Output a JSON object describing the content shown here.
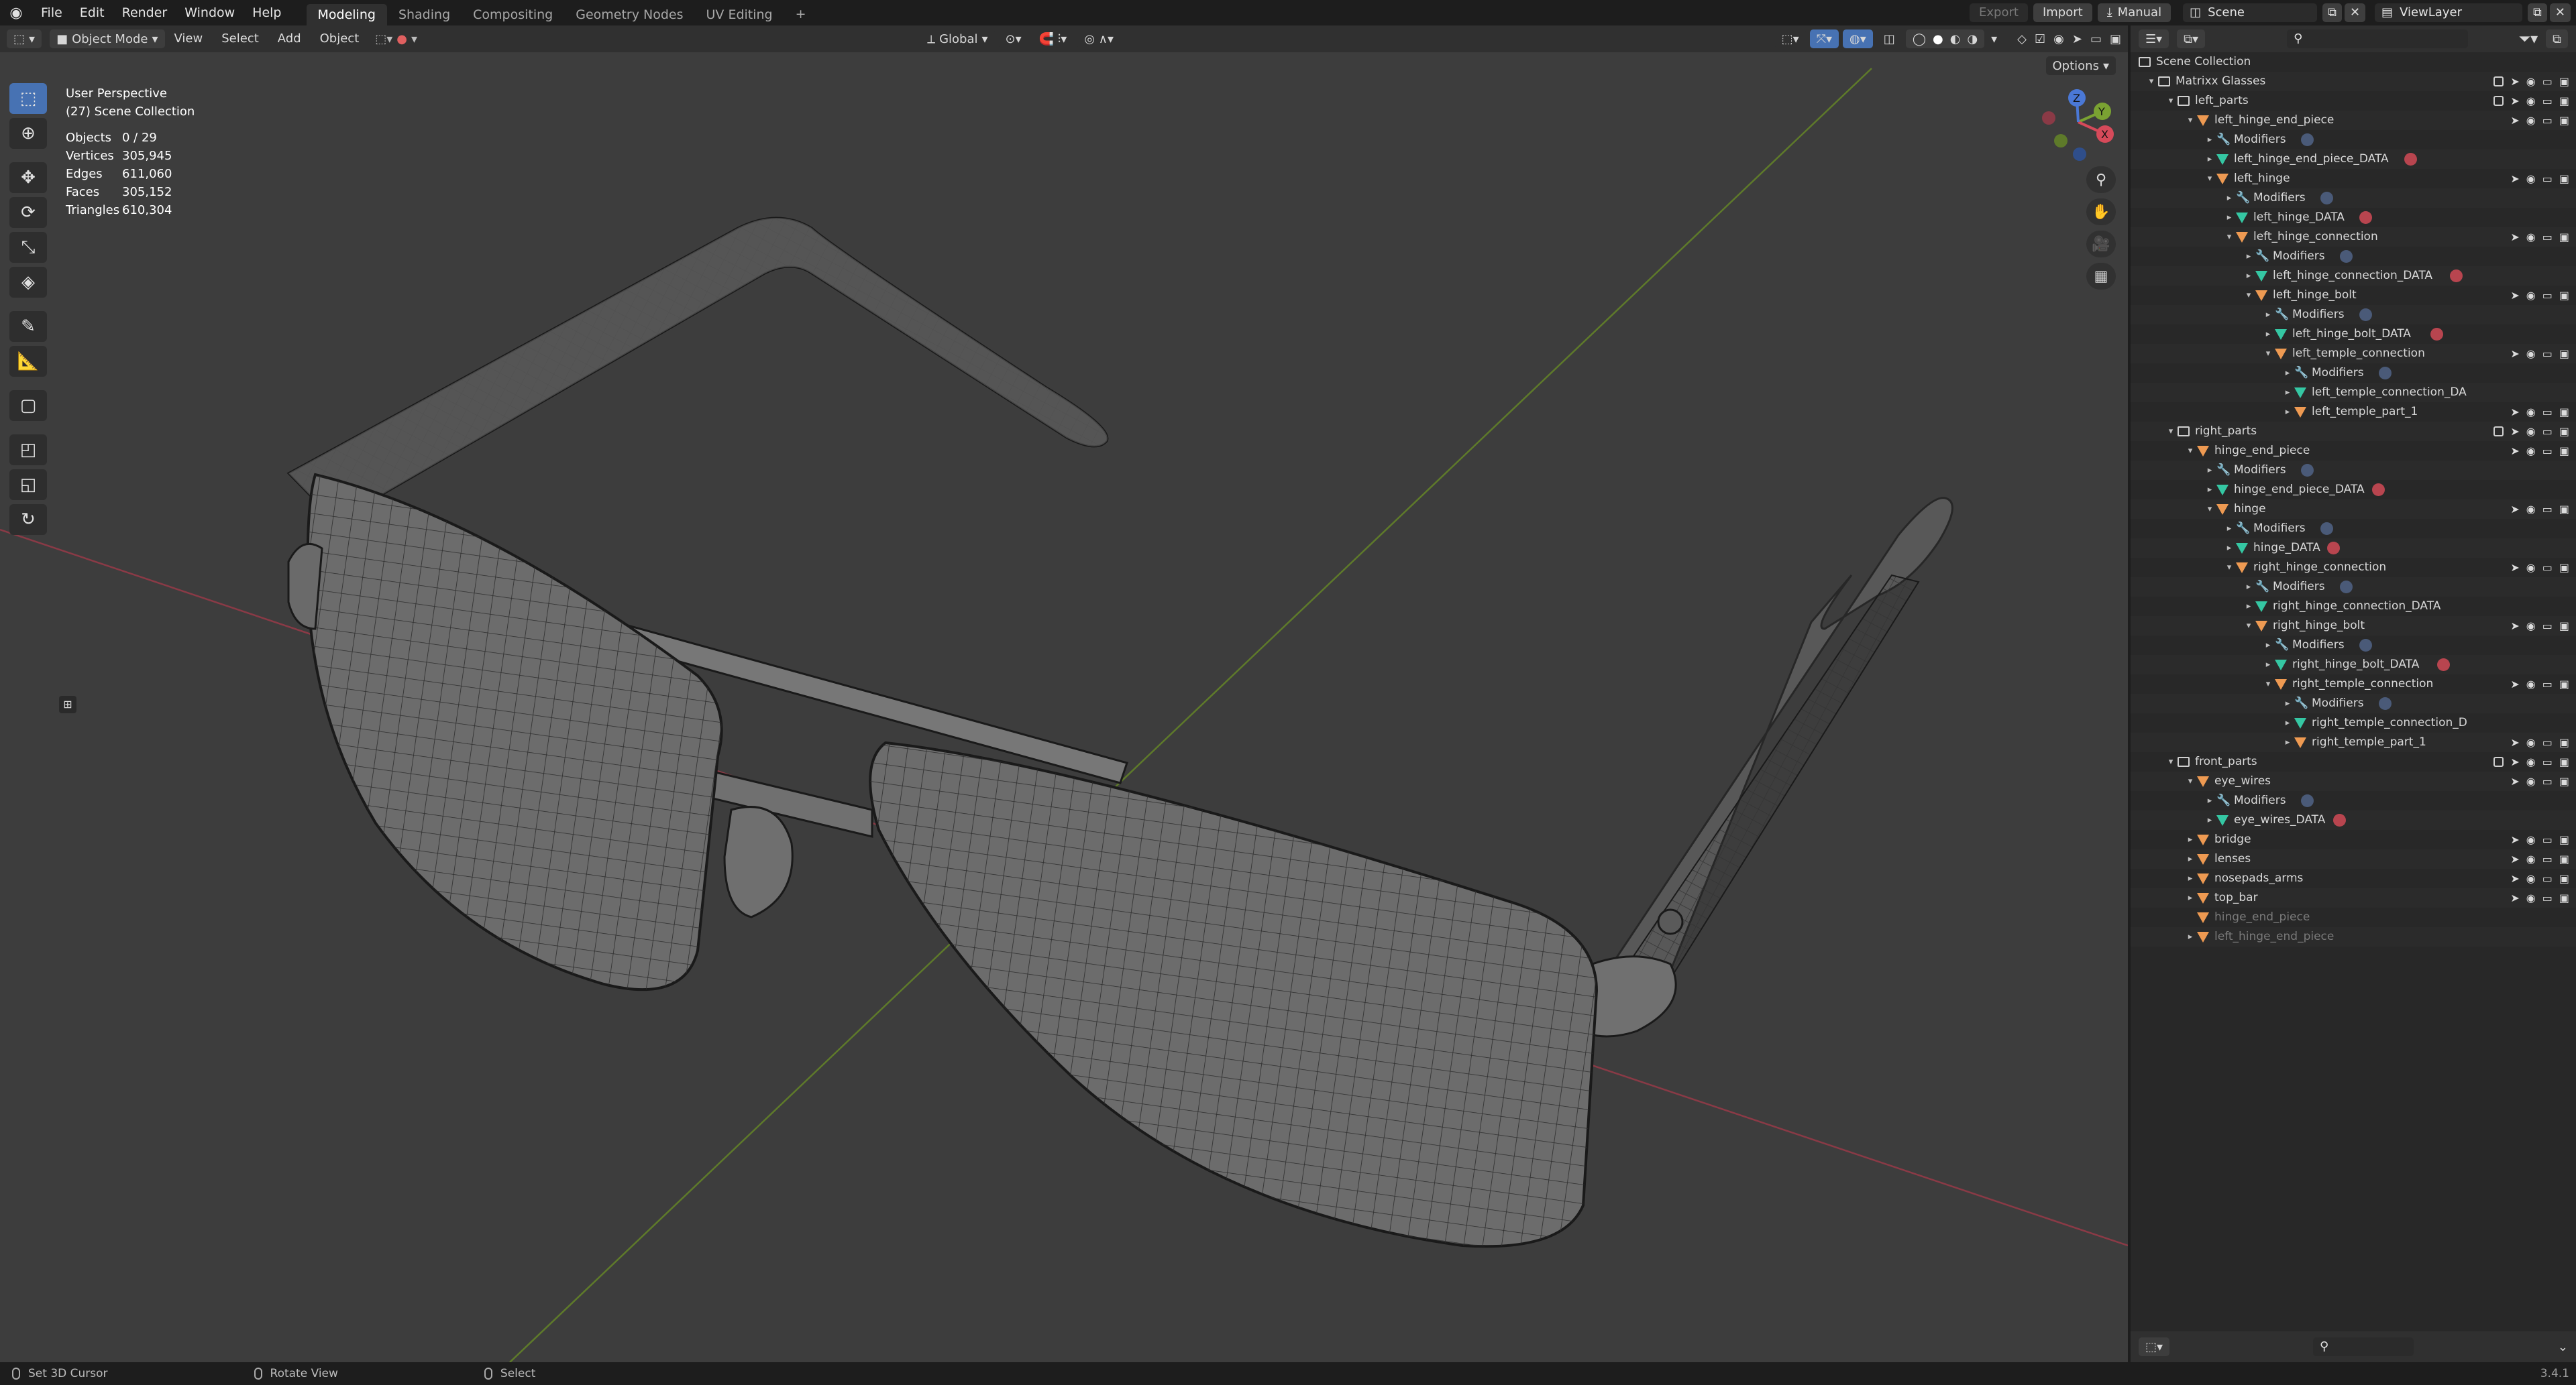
{
  "topbar": {
    "menus": [
      "File",
      "Edit",
      "Render",
      "Window",
      "Help"
    ],
    "workspaces": [
      "Modeling",
      "Shading",
      "Compositing",
      "Geometry Nodes",
      "UV Editing"
    ],
    "active_workspace": "Modeling",
    "add_workspace": "+",
    "export_label": "Export",
    "import_label": "Import",
    "manual_label": "Manual",
    "scene_label": "Scene",
    "viewlayer_label": "ViewLayer"
  },
  "viewport_header": {
    "mode": "Object Mode",
    "view": "View",
    "select": "Select",
    "add": "Add",
    "object": "Object",
    "orientation": "Global",
    "options": "Options"
  },
  "viewport": {
    "perspective": "User Perspective",
    "collection": "(27) Scene Collection",
    "stats": [
      {
        "label": "Objects",
        "value": "0 / 29"
      },
      {
        "label": "Vertices",
        "value": "305,945"
      },
      {
        "label": "Edges",
        "value": "611,060"
      },
      {
        "label": "Faces",
        "value": "305,152"
      },
      {
        "label": "Triangles",
        "value": "610,304"
      }
    ],
    "gizmo": {
      "x": "X",
      "y": "Y",
      "z": "Z"
    }
  },
  "outliner": {
    "rows": [
      {
        "name": "Scene Collection",
        "depth": 0,
        "icon": "coll",
        "arrow": "",
        "ctrls": ""
      },
      {
        "name": "Matrixx Glasses",
        "depth": 1,
        "icon": "coll",
        "arrow": "▾",
        "ctrls": "full"
      },
      {
        "name": "left_parts",
        "depth": 2,
        "icon": "coll",
        "arrow": "▾",
        "ctrls": "full"
      },
      {
        "name": "left_hinge_end_piece",
        "depth": 3,
        "icon": "obj",
        "arrow": "▾",
        "ctrls": "obj"
      },
      {
        "name": "Modifiers",
        "depth": 4,
        "icon": "mod",
        "arrow": "▸",
        "ctrls": "",
        "tag": "mod"
      },
      {
        "name": "left_hinge_end_piece_DATA",
        "depth": 4,
        "icon": "mesh",
        "arrow": "▸",
        "ctrls": "",
        "tag": "mat"
      },
      {
        "name": "left_hinge",
        "depth": 4,
        "icon": "obj",
        "arrow": "▾",
        "ctrls": "obj"
      },
      {
        "name": "Modifiers",
        "depth": 5,
        "icon": "mod",
        "arrow": "▸",
        "ctrls": "",
        "tag": "mod"
      },
      {
        "name": "left_hinge_DATA",
        "depth": 5,
        "icon": "mesh",
        "arrow": "▸",
        "ctrls": "",
        "tag": "mat"
      },
      {
        "name": "left_hinge_connection",
        "depth": 5,
        "icon": "obj",
        "arrow": "▾",
        "ctrls": "obj"
      },
      {
        "name": "Modifiers",
        "depth": 6,
        "icon": "mod",
        "arrow": "▸",
        "ctrls": "",
        "tag": "mod"
      },
      {
        "name": "left_hinge_connection_DATA",
        "depth": 6,
        "icon": "mesh",
        "arrow": "▸",
        "ctrls": "",
        "tag": "mat"
      },
      {
        "name": "left_hinge_bolt",
        "depth": 6,
        "icon": "obj",
        "arrow": "▾",
        "ctrls": "obj"
      },
      {
        "name": "Modifiers",
        "depth": 7,
        "icon": "mod",
        "arrow": "▸",
        "ctrls": "",
        "tag": "mod"
      },
      {
        "name": "left_hinge_bolt_DATA",
        "depth": 7,
        "icon": "mesh",
        "arrow": "▸",
        "ctrls": "",
        "tag": "mat"
      },
      {
        "name": "left_temple_connection",
        "depth": 7,
        "icon": "obj",
        "arrow": "▾",
        "ctrls": "obj"
      },
      {
        "name": "Modifiers",
        "depth": 8,
        "icon": "mod",
        "arrow": "▸",
        "ctrls": "",
        "tag": "mod"
      },
      {
        "name": "left_temple_connection_DA",
        "depth": 8,
        "icon": "mesh",
        "arrow": "▸",
        "ctrls": ""
      },
      {
        "name": "left_temple_part_1",
        "depth": 8,
        "icon": "obj",
        "arrow": "▸",
        "ctrls": "obj"
      },
      {
        "name": "right_parts",
        "depth": 2,
        "icon": "coll",
        "arrow": "▾",
        "ctrls": "full"
      },
      {
        "name": "hinge_end_piece",
        "depth": 3,
        "icon": "obj",
        "arrow": "▾",
        "ctrls": "obj"
      },
      {
        "name": "Modifiers",
        "depth": 4,
        "icon": "mod",
        "arrow": "▸",
        "ctrls": "",
        "tag": "mod"
      },
      {
        "name": "hinge_end_piece_DATA",
        "depth": 4,
        "icon": "mesh",
        "arrow": "▸",
        "ctrls": "",
        "tag": "mat"
      },
      {
        "name": "hinge",
        "depth": 4,
        "icon": "obj",
        "arrow": "▾",
        "ctrls": "obj"
      },
      {
        "name": "Modifiers",
        "depth": 5,
        "icon": "mod",
        "arrow": "▸",
        "ctrls": "",
        "tag": "mod"
      },
      {
        "name": "hinge_DATA",
        "depth": 5,
        "icon": "mesh",
        "arrow": "▸",
        "ctrls": "",
        "tag": "mat"
      },
      {
        "name": "right_hinge_connection",
        "depth": 5,
        "icon": "obj",
        "arrow": "▾",
        "ctrls": "obj"
      },
      {
        "name": "Modifiers",
        "depth": 6,
        "icon": "mod",
        "arrow": "▸",
        "ctrls": "",
        "tag": "mod"
      },
      {
        "name": "right_hinge_connection_DATA",
        "depth": 6,
        "icon": "mesh",
        "arrow": "▸",
        "ctrls": ""
      },
      {
        "name": "right_hinge_bolt",
        "depth": 6,
        "icon": "obj",
        "arrow": "▾",
        "ctrls": "obj"
      },
      {
        "name": "Modifiers",
        "depth": 7,
        "icon": "mod",
        "arrow": "▸",
        "ctrls": "",
        "tag": "mod"
      },
      {
        "name": "right_hinge_bolt_DATA",
        "depth": 7,
        "icon": "mesh",
        "arrow": "▸",
        "ctrls": "",
        "tag": "mat"
      },
      {
        "name": "right_temple_connection",
        "depth": 7,
        "icon": "obj",
        "arrow": "▾",
        "ctrls": "obj"
      },
      {
        "name": "Modifiers",
        "depth": 8,
        "icon": "mod",
        "arrow": "▸",
        "ctrls": "",
        "tag": "mod"
      },
      {
        "name": "right_temple_connection_D",
        "depth": 8,
        "icon": "mesh",
        "arrow": "▸",
        "ctrls": ""
      },
      {
        "name": "right_temple_part_1",
        "depth": 8,
        "icon": "obj",
        "arrow": "▸",
        "ctrls": "obj"
      },
      {
        "name": "front_parts",
        "depth": 2,
        "icon": "coll",
        "arrow": "▾",
        "ctrls": "full"
      },
      {
        "name": "eye_wires",
        "depth": 3,
        "icon": "obj",
        "arrow": "▾",
        "ctrls": "obj"
      },
      {
        "name": "Modifiers",
        "depth": 4,
        "icon": "mod",
        "arrow": "▸",
        "ctrls": "",
        "tag": "mod"
      },
      {
        "name": "eye_wires_DATA",
        "depth": 4,
        "icon": "mesh",
        "arrow": "▸",
        "ctrls": "",
        "tag": "mat"
      },
      {
        "name": "bridge",
        "depth": 3,
        "icon": "obj",
        "arrow": "▸",
        "ctrls": "obj"
      },
      {
        "name": "lenses",
        "depth": 3,
        "icon": "obj",
        "arrow": "▸",
        "ctrls": "obj"
      },
      {
        "name": "nosepads_arms",
        "depth": 3,
        "icon": "obj",
        "arrow": "▸",
        "ctrls": "obj"
      },
      {
        "name": "top_bar",
        "depth": 3,
        "icon": "obj",
        "arrow": "▸",
        "ctrls": "obj"
      },
      {
        "name": "hinge_end_piece",
        "depth": 3,
        "icon": "obj",
        "arrow": "",
        "ctrls": "",
        "dim": true
      },
      {
        "name": "left_hinge_end_piece",
        "depth": 3,
        "icon": "obj",
        "arrow": "▸",
        "ctrls": "",
        "dim": true
      }
    ]
  },
  "statusbar": {
    "left": "Set 3D Cursor",
    "middle": "Rotate View",
    "right": "Select",
    "version": "3.4.1"
  }
}
